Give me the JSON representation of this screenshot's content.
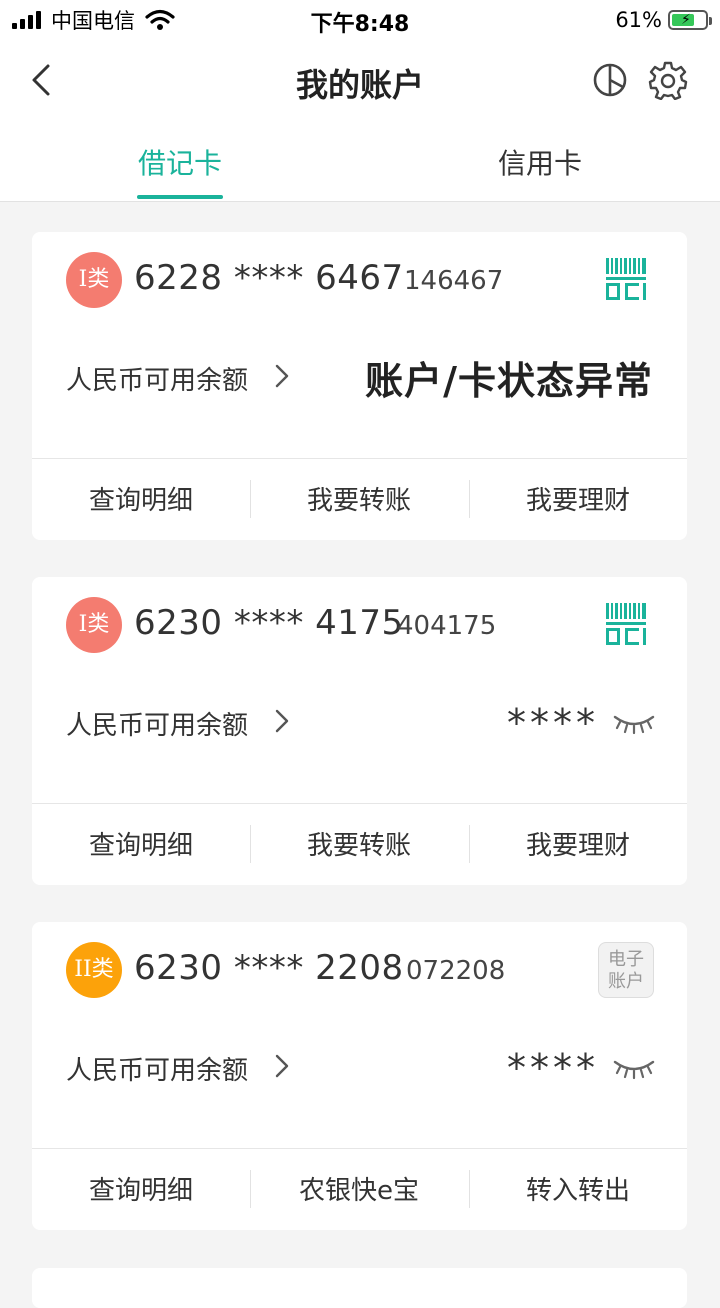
{
  "status_bar": {
    "carrier": "中国电信",
    "time": "下午8:48",
    "battery": "61%"
  },
  "nav": {
    "title": "我的账户",
    "icons": [
      "back-arrow-icon",
      "pie-chart-icon",
      "gear-icon"
    ]
  },
  "tabs": [
    {
      "label": "借记卡",
      "active": true
    },
    {
      "label": "信用卡",
      "active": false
    }
  ],
  "colors": {
    "accent": "#1ab39b",
    "class1_badge": "#f47c70",
    "class2_badge": "#fca20a"
  },
  "cards": [
    {
      "badge": "I类",
      "number": "6228 **** 6467",
      "tail": "146467",
      "balance_label": "人民币可用余额",
      "status": "账户/卡状态异常",
      "actions": [
        "查询明细",
        "我要转账",
        "我要理财"
      ]
    },
    {
      "badge": "I类",
      "number": "6230 **** 4175",
      "tail": "404175",
      "balance_label": "人民币可用余额",
      "masked_balance": "****",
      "actions": [
        "查询明细",
        "我要转账",
        "我要理财"
      ]
    },
    {
      "badge": "II类",
      "number": "6230 **** 2208",
      "tail": "072208",
      "tag_line1": "电子",
      "tag_line2": "账户",
      "balance_label": "人民币可用余额",
      "masked_balance": "****",
      "actions": [
        "查询明细",
        "农银快e宝",
        "转入转出"
      ]
    }
  ]
}
